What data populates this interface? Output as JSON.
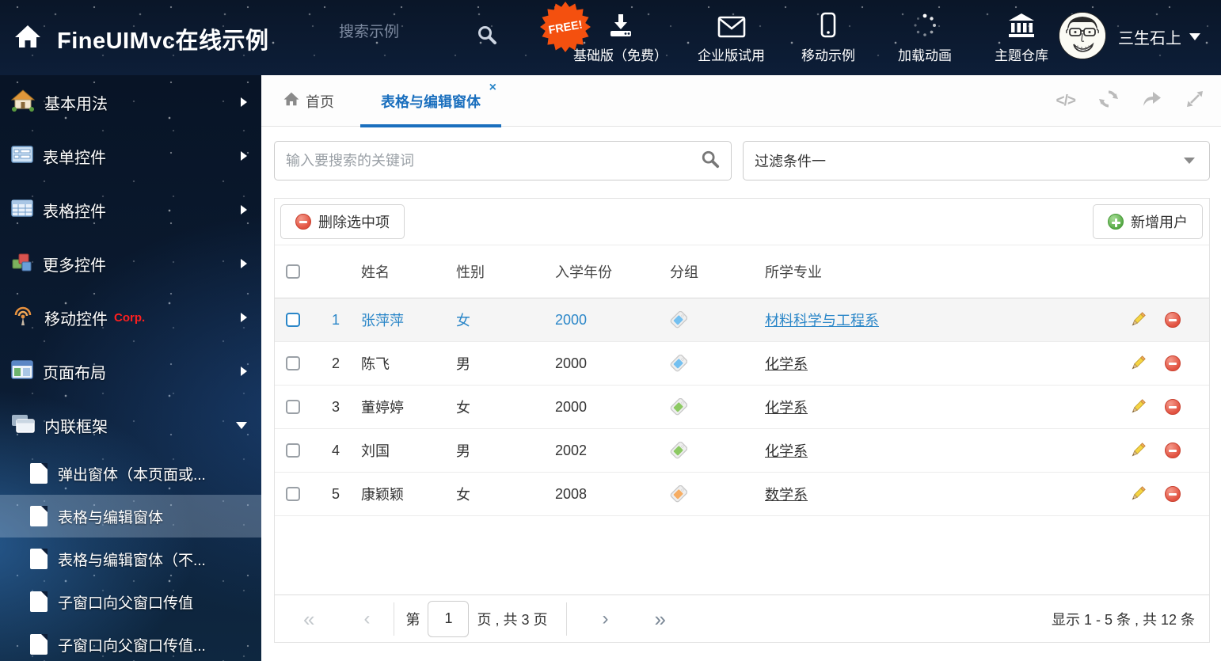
{
  "header": {
    "title": "FineUIMvc在线示例",
    "search_placeholder": "搜索示例",
    "free_badge": "FREE!",
    "nav_items": [
      {
        "icon": "download-icon",
        "label": "基础版（免费）"
      },
      {
        "icon": "envelope-icon",
        "label": "企业版试用"
      },
      {
        "icon": "mobile-icon",
        "label": "移动示例"
      },
      {
        "icon": "spinner-icon",
        "label": "加载动画"
      },
      {
        "icon": "bank-icon",
        "label": "主题仓库"
      }
    ],
    "user_name": "三生石上"
  },
  "sidebar": {
    "items": [
      {
        "label": "基本用法"
      },
      {
        "label": "表单控件"
      },
      {
        "label": "表格控件"
      },
      {
        "label": "更多控件"
      },
      {
        "label": "移动控件",
        "badge": "Corp."
      },
      {
        "label": "页面布局"
      },
      {
        "label": "内联框架"
      }
    ],
    "subitems": [
      {
        "label": "弹出窗体（本页面或..."
      },
      {
        "label": "表格与编辑窗体"
      },
      {
        "label": "表格与编辑窗体（不..."
      },
      {
        "label": "子窗口向父窗口传值"
      },
      {
        "label": "子窗口向父窗口传值..."
      }
    ]
  },
  "tabs": {
    "home": "首页",
    "active": "表格与编辑窗体"
  },
  "icons": {
    "close_tab": "×",
    "code": "</>",
    "first_page": "«",
    "prev_page": "‹",
    "next_page": "›",
    "last_page": "»"
  },
  "filters": {
    "search_placeholder": "输入要搜索的关键词",
    "filter_dropdown_value": "过滤条件一"
  },
  "grid": {
    "toolbar": {
      "delete_button": "删除选中项",
      "add_button": "新增用户"
    },
    "columns": {
      "name": "姓名",
      "gender": "性别",
      "year": "入学年份",
      "group": "分组",
      "major": "所学专业"
    },
    "rows": [
      {
        "num": "1",
        "name": "张萍萍",
        "gender": "女",
        "year": "2000",
        "tag": "tag-blue",
        "major": "材料科学与工程系"
      },
      {
        "num": "2",
        "name": "陈飞",
        "gender": "男",
        "year": "2000",
        "tag": "tag-blue",
        "major": "化学系"
      },
      {
        "num": "3",
        "name": "董婷婷",
        "gender": "女",
        "year": "2000",
        "tag": "tag-green",
        "major": "化学系"
      },
      {
        "num": "4",
        "name": "刘国",
        "gender": "男",
        "year": "2002",
        "tag": "tag-green",
        "major": "化学系"
      },
      {
        "num": "5",
        "name": "康颖颖",
        "gender": "女",
        "year": "2008",
        "tag": "tag-orange",
        "major": "数学系"
      }
    ],
    "pagination": {
      "prefix": "第",
      "current_page": "1",
      "suffix": "页 , 共 3 页",
      "summary": "显示 1 - 5 条 , 共 12 条"
    }
  }
}
